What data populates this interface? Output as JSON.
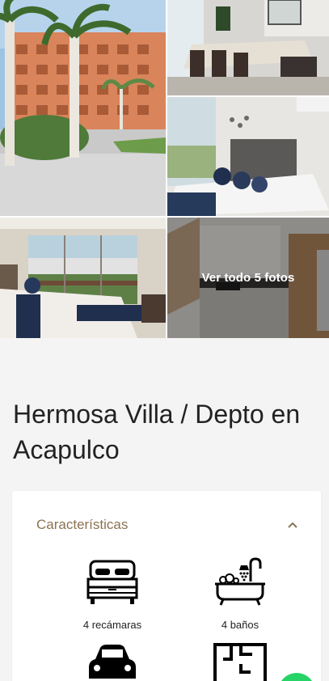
{
  "gallery": {
    "images": [
      {
        "alt": "palm-trees-resort-photo"
      },
      {
        "alt": "dining-room-photo"
      },
      {
        "alt": "bedroom-photo"
      },
      {
        "alt": "bedroom-balcony-photo"
      },
      {
        "alt": "kitchen-photo"
      }
    ],
    "see_all_label": "Ver todo 5 fotos"
  },
  "listing": {
    "title": "Hermosa Villa / Depto en Acapulco"
  },
  "features": {
    "heading": "Características",
    "collapse_icon": "chevron-up-icon",
    "items": [
      {
        "icon": "bed-icon",
        "label": "4 recámaras"
      },
      {
        "icon": "bathtub-icon",
        "label": "4 baños"
      },
      {
        "icon": "car-icon",
        "label": ""
      },
      {
        "icon": "floorplan-icon",
        "label": ""
      }
    ]
  },
  "colors": {
    "accent": "#8a7352",
    "whatsapp": "#25d366",
    "background": "#f4f4f4"
  }
}
